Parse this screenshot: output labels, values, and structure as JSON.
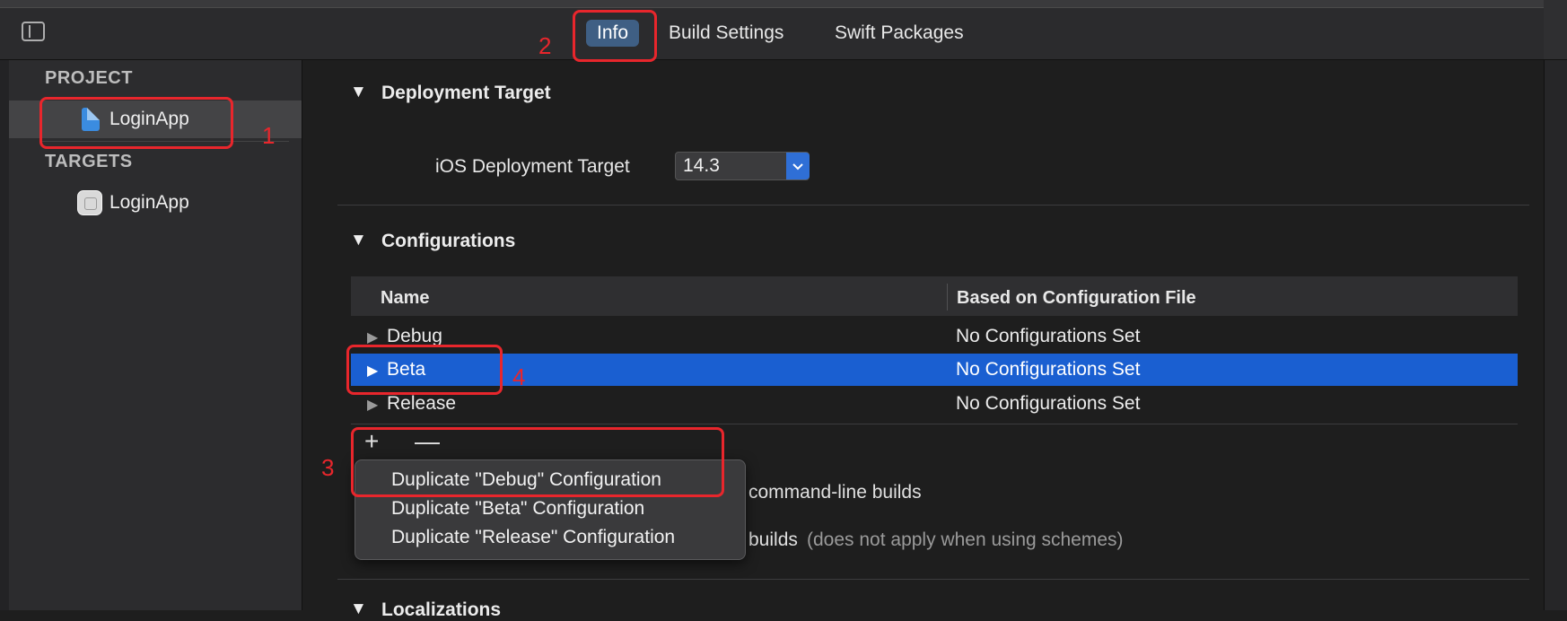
{
  "toolbar": {
    "tabs": [
      {
        "label": "Info",
        "selected": true
      },
      {
        "label": "Build Settings",
        "selected": false
      },
      {
        "label": "Swift Packages",
        "selected": false
      }
    ]
  },
  "sidebar": {
    "project_header": "PROJECT",
    "project_item": "LoginApp",
    "targets_header": "TARGETS",
    "target_item": "LoginApp"
  },
  "deployment": {
    "section_title": "Deployment Target",
    "field_label": "iOS Deployment Target",
    "field_value": "14.3"
  },
  "configurations": {
    "section_title": "Configurations",
    "columns": [
      "Name",
      "Based on Configuration File"
    ],
    "rows": [
      {
        "name": "Debug",
        "file": "No Configurations Set",
        "selected": false
      },
      {
        "name": "Beta",
        "file": "No Configurations Set",
        "selected": true
      },
      {
        "name": "Release",
        "file": "No Configurations Set",
        "selected": false
      }
    ],
    "add_symbol": "+",
    "remove_symbol": "—",
    "commandline_text": "command-line builds",
    "schemes_text": "builds",
    "schemes_note": "(does not apply when using schemes)"
  },
  "menu": {
    "items": [
      "Duplicate \"Debug\" Configuration",
      "Duplicate \"Beta\" Configuration",
      "Duplicate \"Release\" Configuration"
    ]
  },
  "localizations": {
    "section_title": "Localizations"
  },
  "annotations": {
    "numbers": [
      "1",
      "2",
      "3",
      "4"
    ],
    "color": "#e8262c"
  },
  "colors": {
    "accent": "#1a5fd1",
    "selected_tab": "#3f5f84"
  }
}
